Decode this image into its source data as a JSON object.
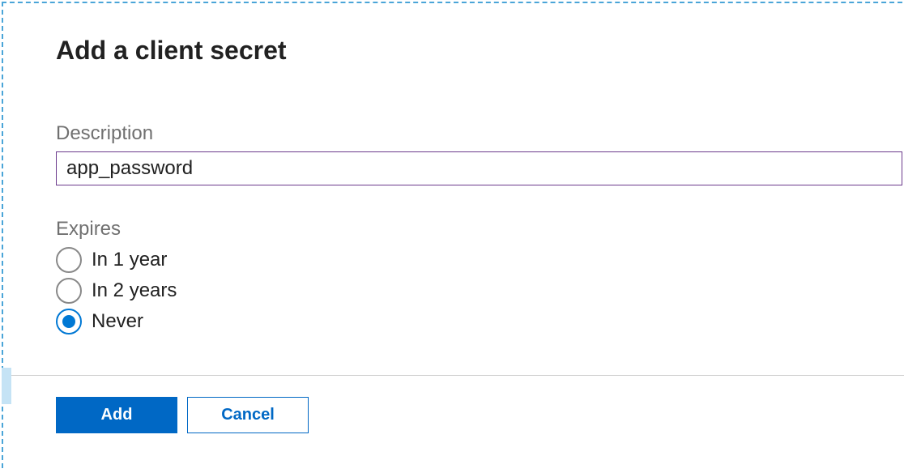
{
  "panel": {
    "title": "Add a client secret"
  },
  "description": {
    "label": "Description",
    "value": "app_password"
  },
  "expires": {
    "label": "Expires",
    "options": [
      {
        "label": "In 1 year",
        "selected": false
      },
      {
        "label": "In 2 years",
        "selected": false
      },
      {
        "label": "Never",
        "selected": true
      }
    ]
  },
  "buttons": {
    "add": "Add",
    "cancel": "Cancel"
  }
}
